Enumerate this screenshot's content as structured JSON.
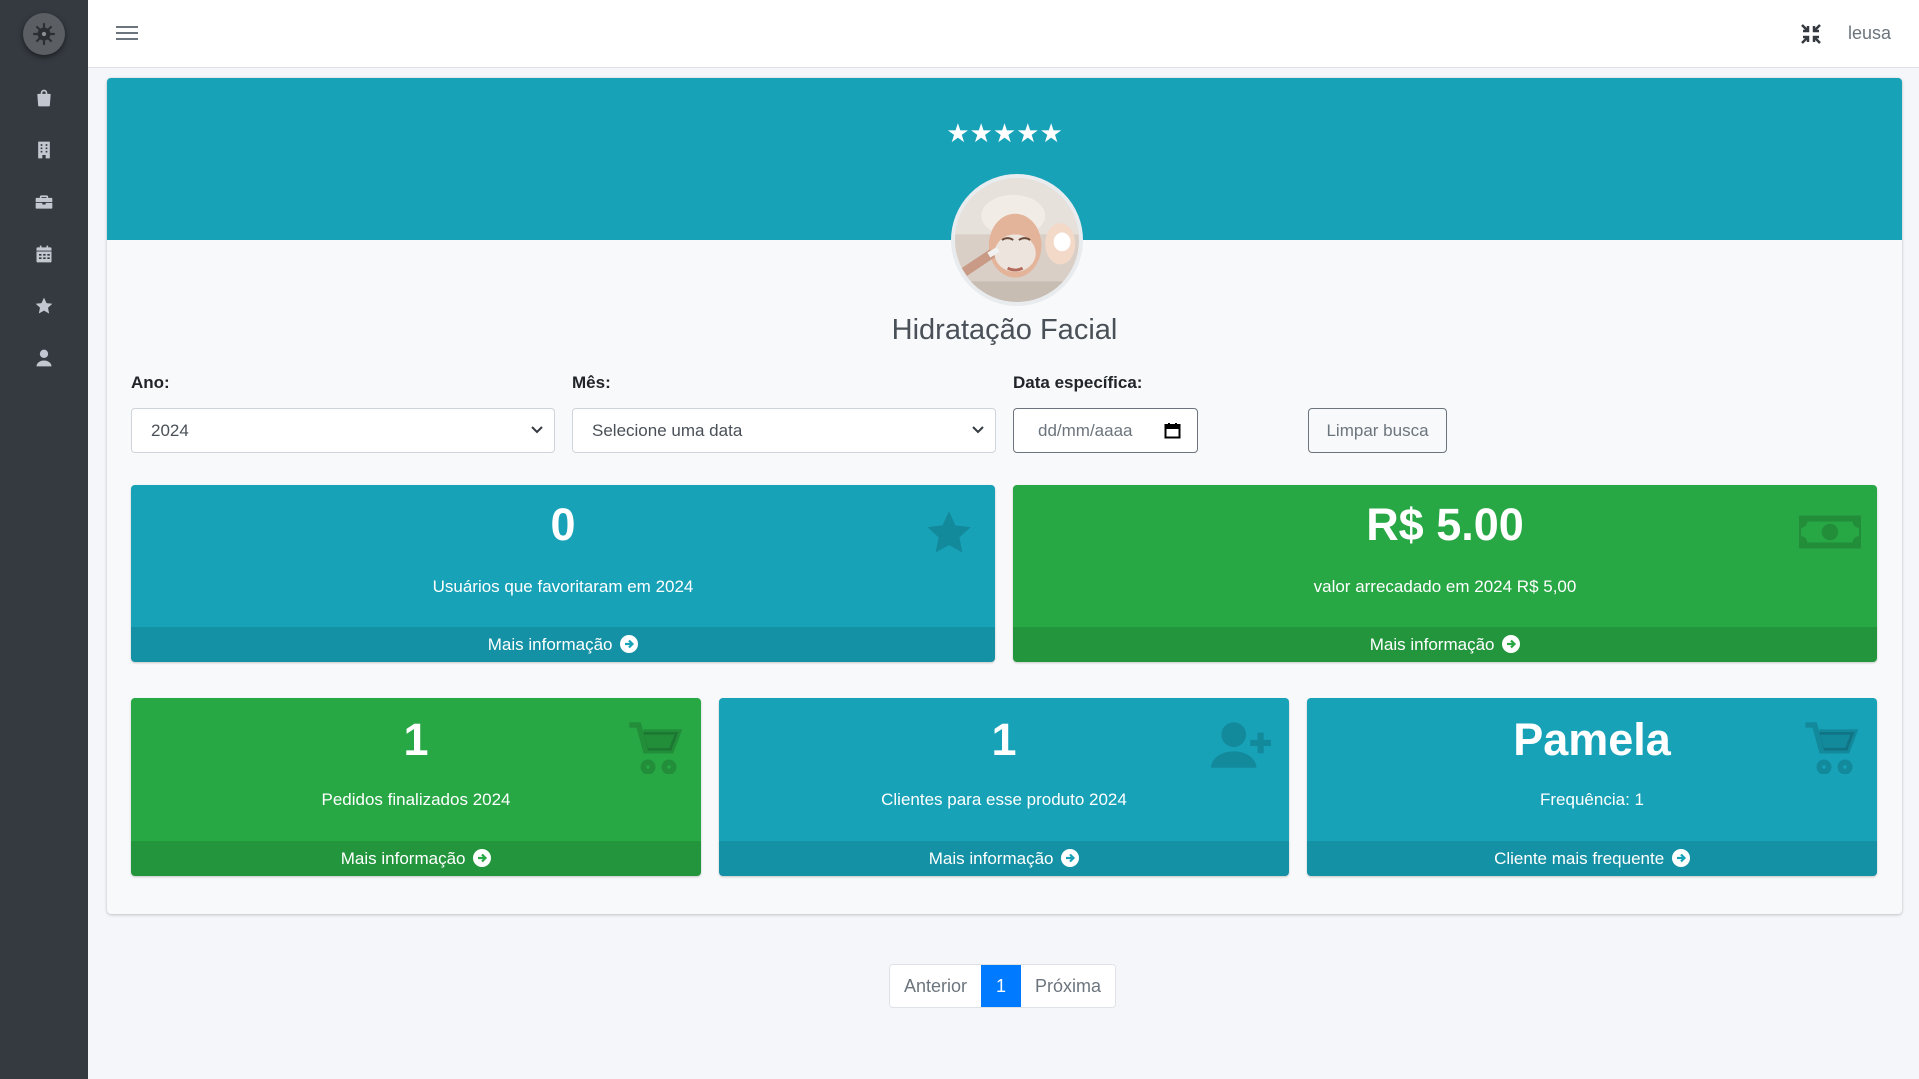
{
  "app": {
    "user_name": "leusa"
  },
  "sidebar": {
    "items": [
      {
        "icon": "shopping-bag-icon"
      },
      {
        "icon": "building-icon"
      },
      {
        "icon": "briefcase-icon"
      },
      {
        "icon": "calendar-icon"
      },
      {
        "icon": "star-icon"
      },
      {
        "icon": "user-icon"
      }
    ]
  },
  "product": {
    "rating_stars": "★★★★★",
    "rating": 5,
    "title": "Hidratação Facial"
  },
  "filters": {
    "year_label": "Ano:",
    "year_value": "2024",
    "month_label": "Mês:",
    "month_value": "Selecione uma data",
    "date_label": "Data específica:",
    "date_placeholder": "dd/mm/aaaa",
    "clear_label": "Limpar busca"
  },
  "stats": {
    "favorites": {
      "value": "0",
      "caption": "Usuários que favoritaram em 2024",
      "footer": "Mais informação",
      "icon": "star-icon"
    },
    "revenue": {
      "value": "R$ 5.00",
      "caption": "valor arrecadado em 2024 R$ 5,00",
      "footer": "Mais informação",
      "icon": "money-bill-icon"
    },
    "orders": {
      "value": "1",
      "caption": "Pedidos finalizados 2024",
      "footer": "Mais informação",
      "icon": "cart-icon"
    },
    "clients": {
      "value": "1",
      "caption": "Clientes para esse produto 2024",
      "footer": "Mais informação",
      "icon": "user-plus-icon"
    },
    "frequent": {
      "value": "Pamela",
      "caption": "Frequência: 1",
      "footer": "Cliente mais frequente",
      "icon": "cart-icon"
    }
  },
  "pagination": {
    "prev": "Anterior",
    "current": "1",
    "next": "Próxima"
  },
  "colors": {
    "info": "#17a2b8",
    "success": "#28a745",
    "sidebar": "#343a40",
    "primary": "#007bff"
  }
}
